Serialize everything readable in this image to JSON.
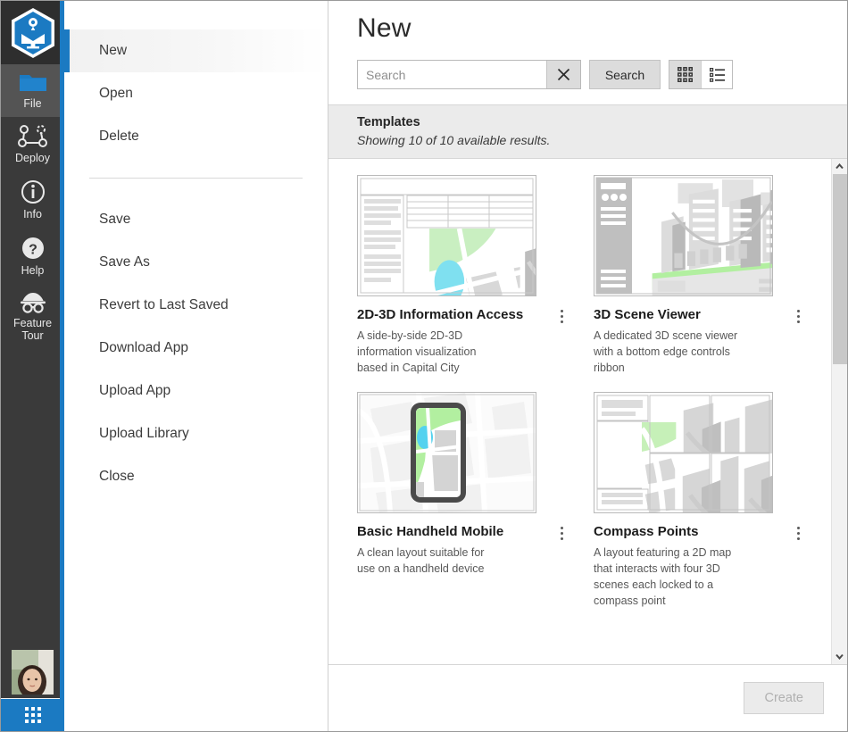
{
  "rail": {
    "logo_icon": "appstudio-hex-logo",
    "items": [
      {
        "label": "File",
        "icon": "folder-icon",
        "active": true
      },
      {
        "label": "Deploy",
        "icon": "deploy-nodes-icon",
        "active": false
      },
      {
        "label": "Info",
        "icon": "info-circle-icon",
        "active": false
      },
      {
        "label": "Help",
        "icon": "question-circle-icon",
        "active": false
      },
      {
        "label": "Feature Tour",
        "icon": "disguise-glasses-icon",
        "active": false
      }
    ],
    "avatar_name": "user-avatar",
    "apps_button": "app-grid-button",
    "accent_color": "#1b7ac2"
  },
  "menu": {
    "items": [
      {
        "label": "New",
        "selected": true
      },
      {
        "label": "Open",
        "selected": false
      },
      {
        "label": "Delete",
        "selected": false
      },
      {
        "separator": true
      },
      {
        "label": "Save",
        "selected": false
      },
      {
        "label": "Save As",
        "selected": false
      },
      {
        "label": "Revert to Last Saved",
        "selected": false
      },
      {
        "label": "Download App",
        "selected": false
      },
      {
        "label": "Upload App",
        "selected": false
      },
      {
        "label": "Upload Library",
        "selected": false
      },
      {
        "label": "Close",
        "selected": false
      }
    ]
  },
  "content": {
    "title": "New",
    "search": {
      "value": "",
      "placeholder": "Search",
      "clear_icon": "close-x-icon",
      "button_label": "Search"
    },
    "view_toggle": {
      "grid_label": "grid-view",
      "list_label": "list-view",
      "selected": "grid-view"
    },
    "section": {
      "title": "Templates",
      "subtitle": "Showing 10 of 10 available results."
    },
    "templates": [
      {
        "title": "2D-3D Information Access",
        "description": "A side-by-side 2D-3D information visualization based in Capital City",
        "thumb": "2d-3d-split-map-thumbnail"
      },
      {
        "title": "3D Scene Viewer",
        "description": "A dedicated 3D scene viewer with a bottom edge controls ribbon",
        "thumb": "3d-scene-thumbnail"
      },
      {
        "title": "Basic Handheld Mobile",
        "description": "A clean layout suitable for use on a handheld device",
        "thumb": "handheld-phone-map-thumbnail"
      },
      {
        "title": "Compass Points",
        "description": "A layout featuring a 2D map that interacts with four 3D scenes each locked to a compass point",
        "thumb": "compass-points-quad-thumbnail"
      }
    ],
    "scrollbar": {
      "up_icon": "chevron-up-icon",
      "down_icon": "chevron-down-icon",
      "thumb_position_percent": 0
    },
    "create_button": {
      "label": "Create",
      "disabled": true
    }
  }
}
